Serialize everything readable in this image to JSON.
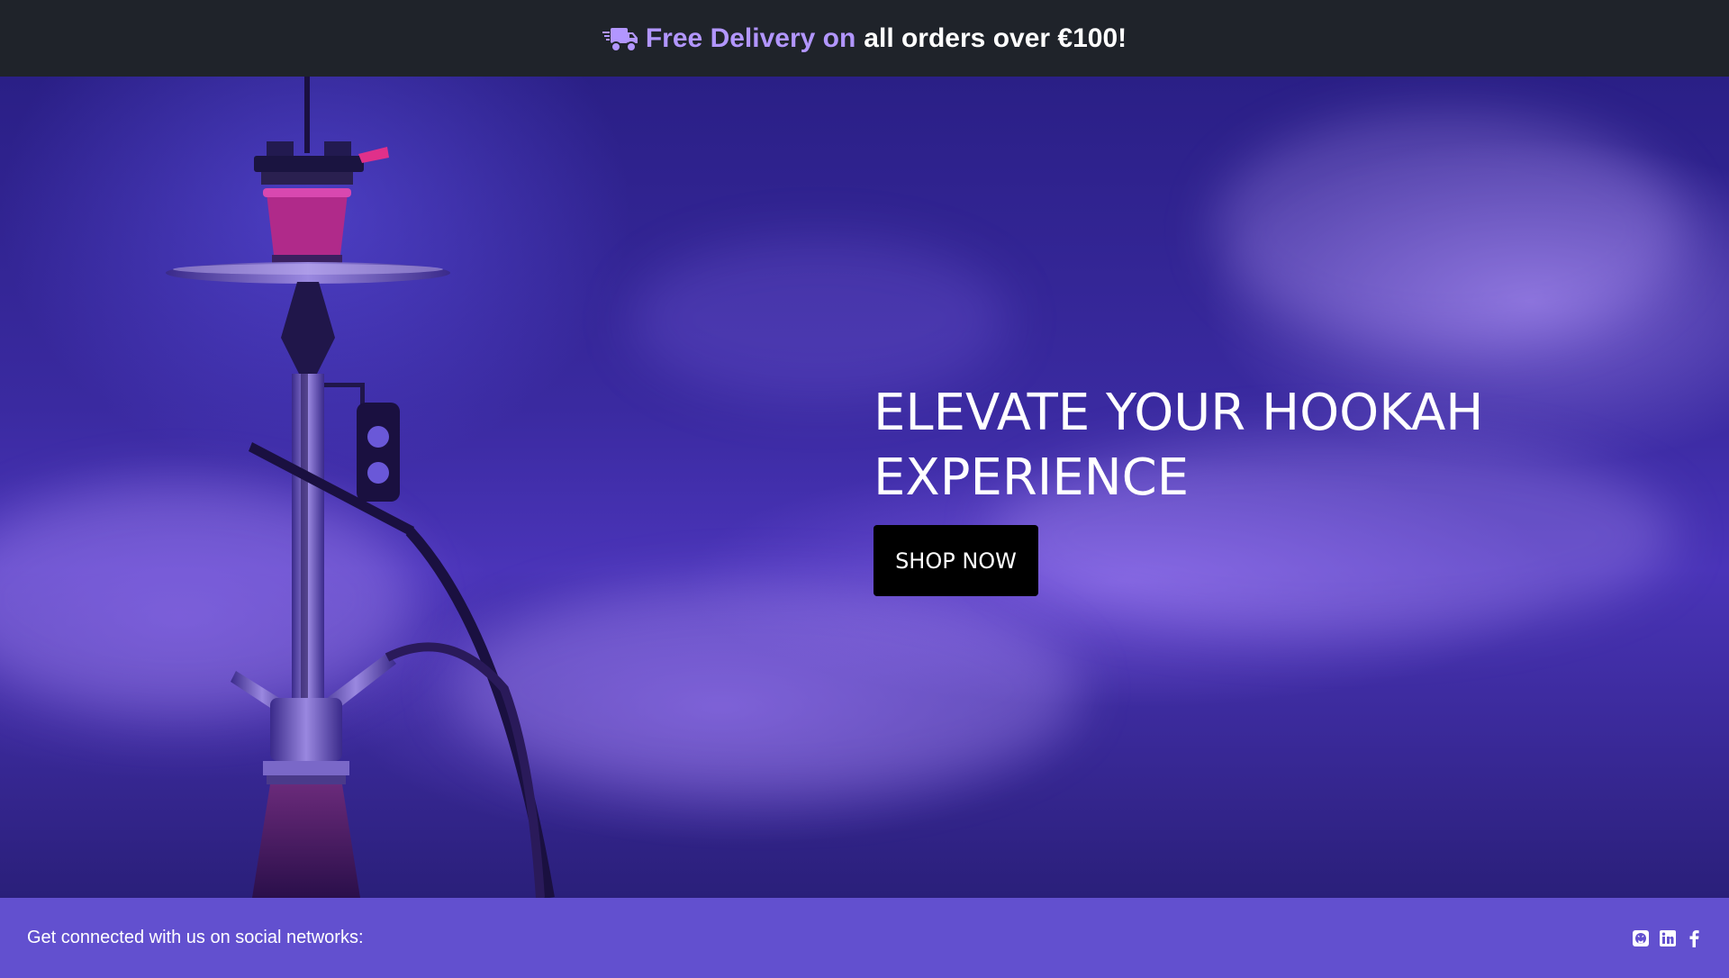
{
  "announcement": {
    "icon": "delivery-truck-icon",
    "highlight": "Free Delivery on",
    "text": "all orders over €100!",
    "accent_color": "#b296ff",
    "background": "#1f232a"
  },
  "hero": {
    "title": "ELEVATE YOUR HOOKAH EXPERIENCE",
    "button_label": "SHOP NOW",
    "image": "hookah-in-purple-smoke"
  },
  "footer": {
    "text": "Get connected with us on social networks:",
    "background": "#6250cf",
    "social_icons": [
      "github-icon",
      "linkedin-icon",
      "facebook-icon"
    ]
  }
}
